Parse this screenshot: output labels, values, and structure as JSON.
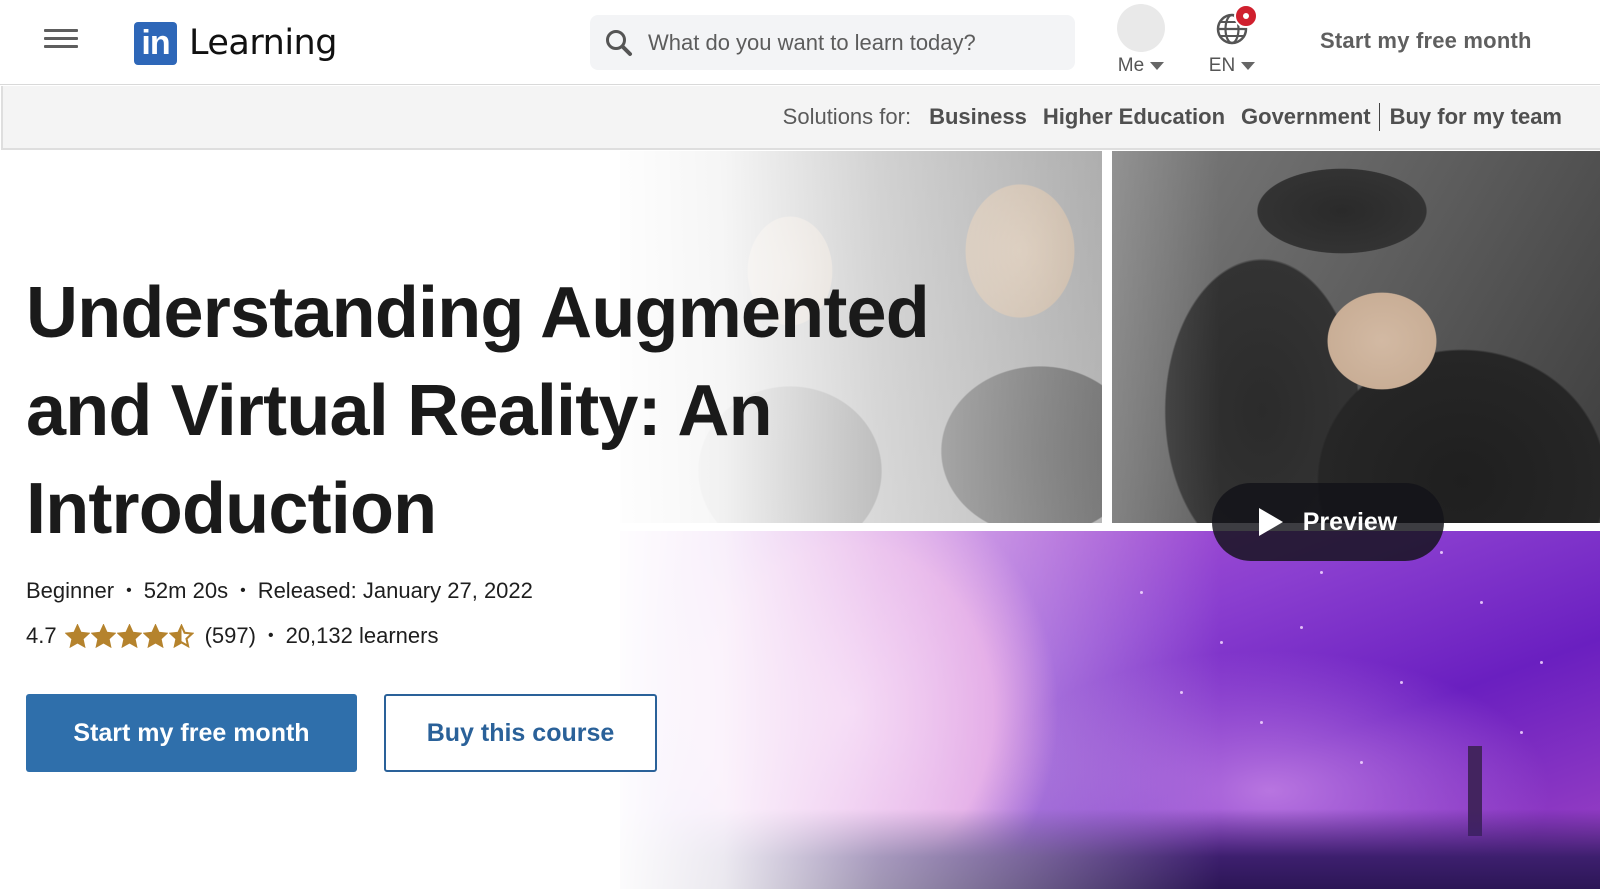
{
  "header": {
    "logo_badge": "in",
    "logo_text": "Learning",
    "search": {
      "placeholder": "What do you want to learn today?",
      "value": ""
    },
    "me_label": "Me",
    "language_label": "EN",
    "cta_label": "Start my free month"
  },
  "solutions_bar": {
    "label": "Solutions for:",
    "links": [
      "Business",
      "Higher Education",
      "Government"
    ],
    "buy_team_label": "Buy for my team"
  },
  "course": {
    "title": "Understanding Augmented and Virtual Reality: An Introduction",
    "level": "Beginner",
    "duration": "52m 20s",
    "released": "Released: January 27, 2022",
    "rating_value": "4.7",
    "rating_stars": 4.7,
    "rating_count": "(597)",
    "learners": "20,132 learners",
    "separator": "•"
  },
  "actions": {
    "primary_label": "Start my free month",
    "secondary_label": "Buy this course",
    "preview_label": "Preview"
  },
  "colors": {
    "brand_blue": "#2e67b8",
    "primary_button": "#2f6fab",
    "secondary_border": "#2a6199",
    "star": "#b5832d",
    "notification": "#d0202e"
  }
}
